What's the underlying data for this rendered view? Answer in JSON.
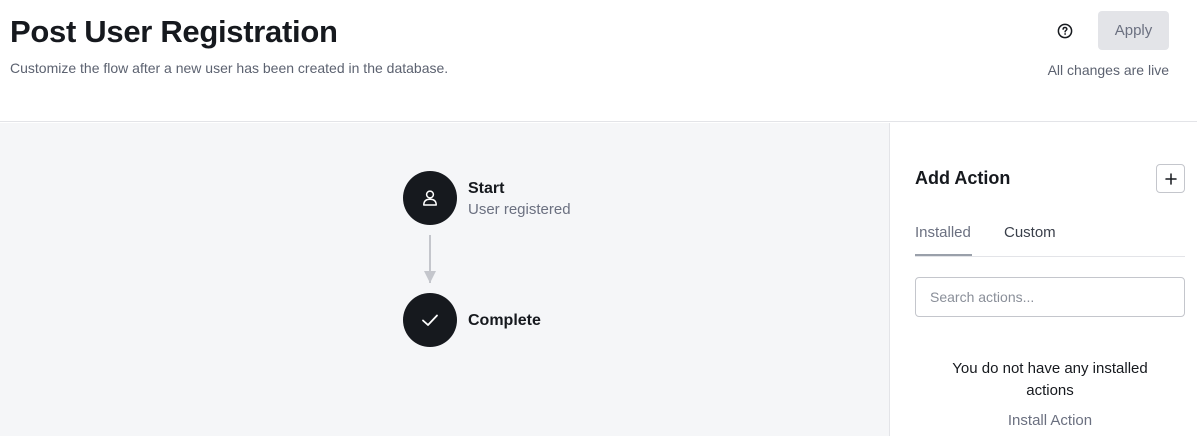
{
  "header": {
    "title": "Post User Registration",
    "subtitle": "Customize the flow after a new user has been created in the database.",
    "help_icon": "question-circle-icon",
    "apply_label": "Apply",
    "live_note": "All changes are live"
  },
  "flow": {
    "start": {
      "icon": "user-icon",
      "title": "Start",
      "subtitle": "User registered"
    },
    "complete": {
      "icon": "check-icon",
      "title": "Complete"
    }
  },
  "panel": {
    "title": "Add Action",
    "add_icon": "plus-icon",
    "tabs": [
      {
        "label": "Installed",
        "active": true
      },
      {
        "label": "Custom",
        "active": false
      }
    ],
    "search_placeholder": "Search actions...",
    "empty_message": "You do not have any installed actions",
    "install_link": "Install Action"
  },
  "colors": {
    "node_fill": "#16191e",
    "canvas_bg": "#f5f6f8",
    "button_disabled_bg": "#e3e4e8",
    "muted_text": "#6b7080"
  }
}
